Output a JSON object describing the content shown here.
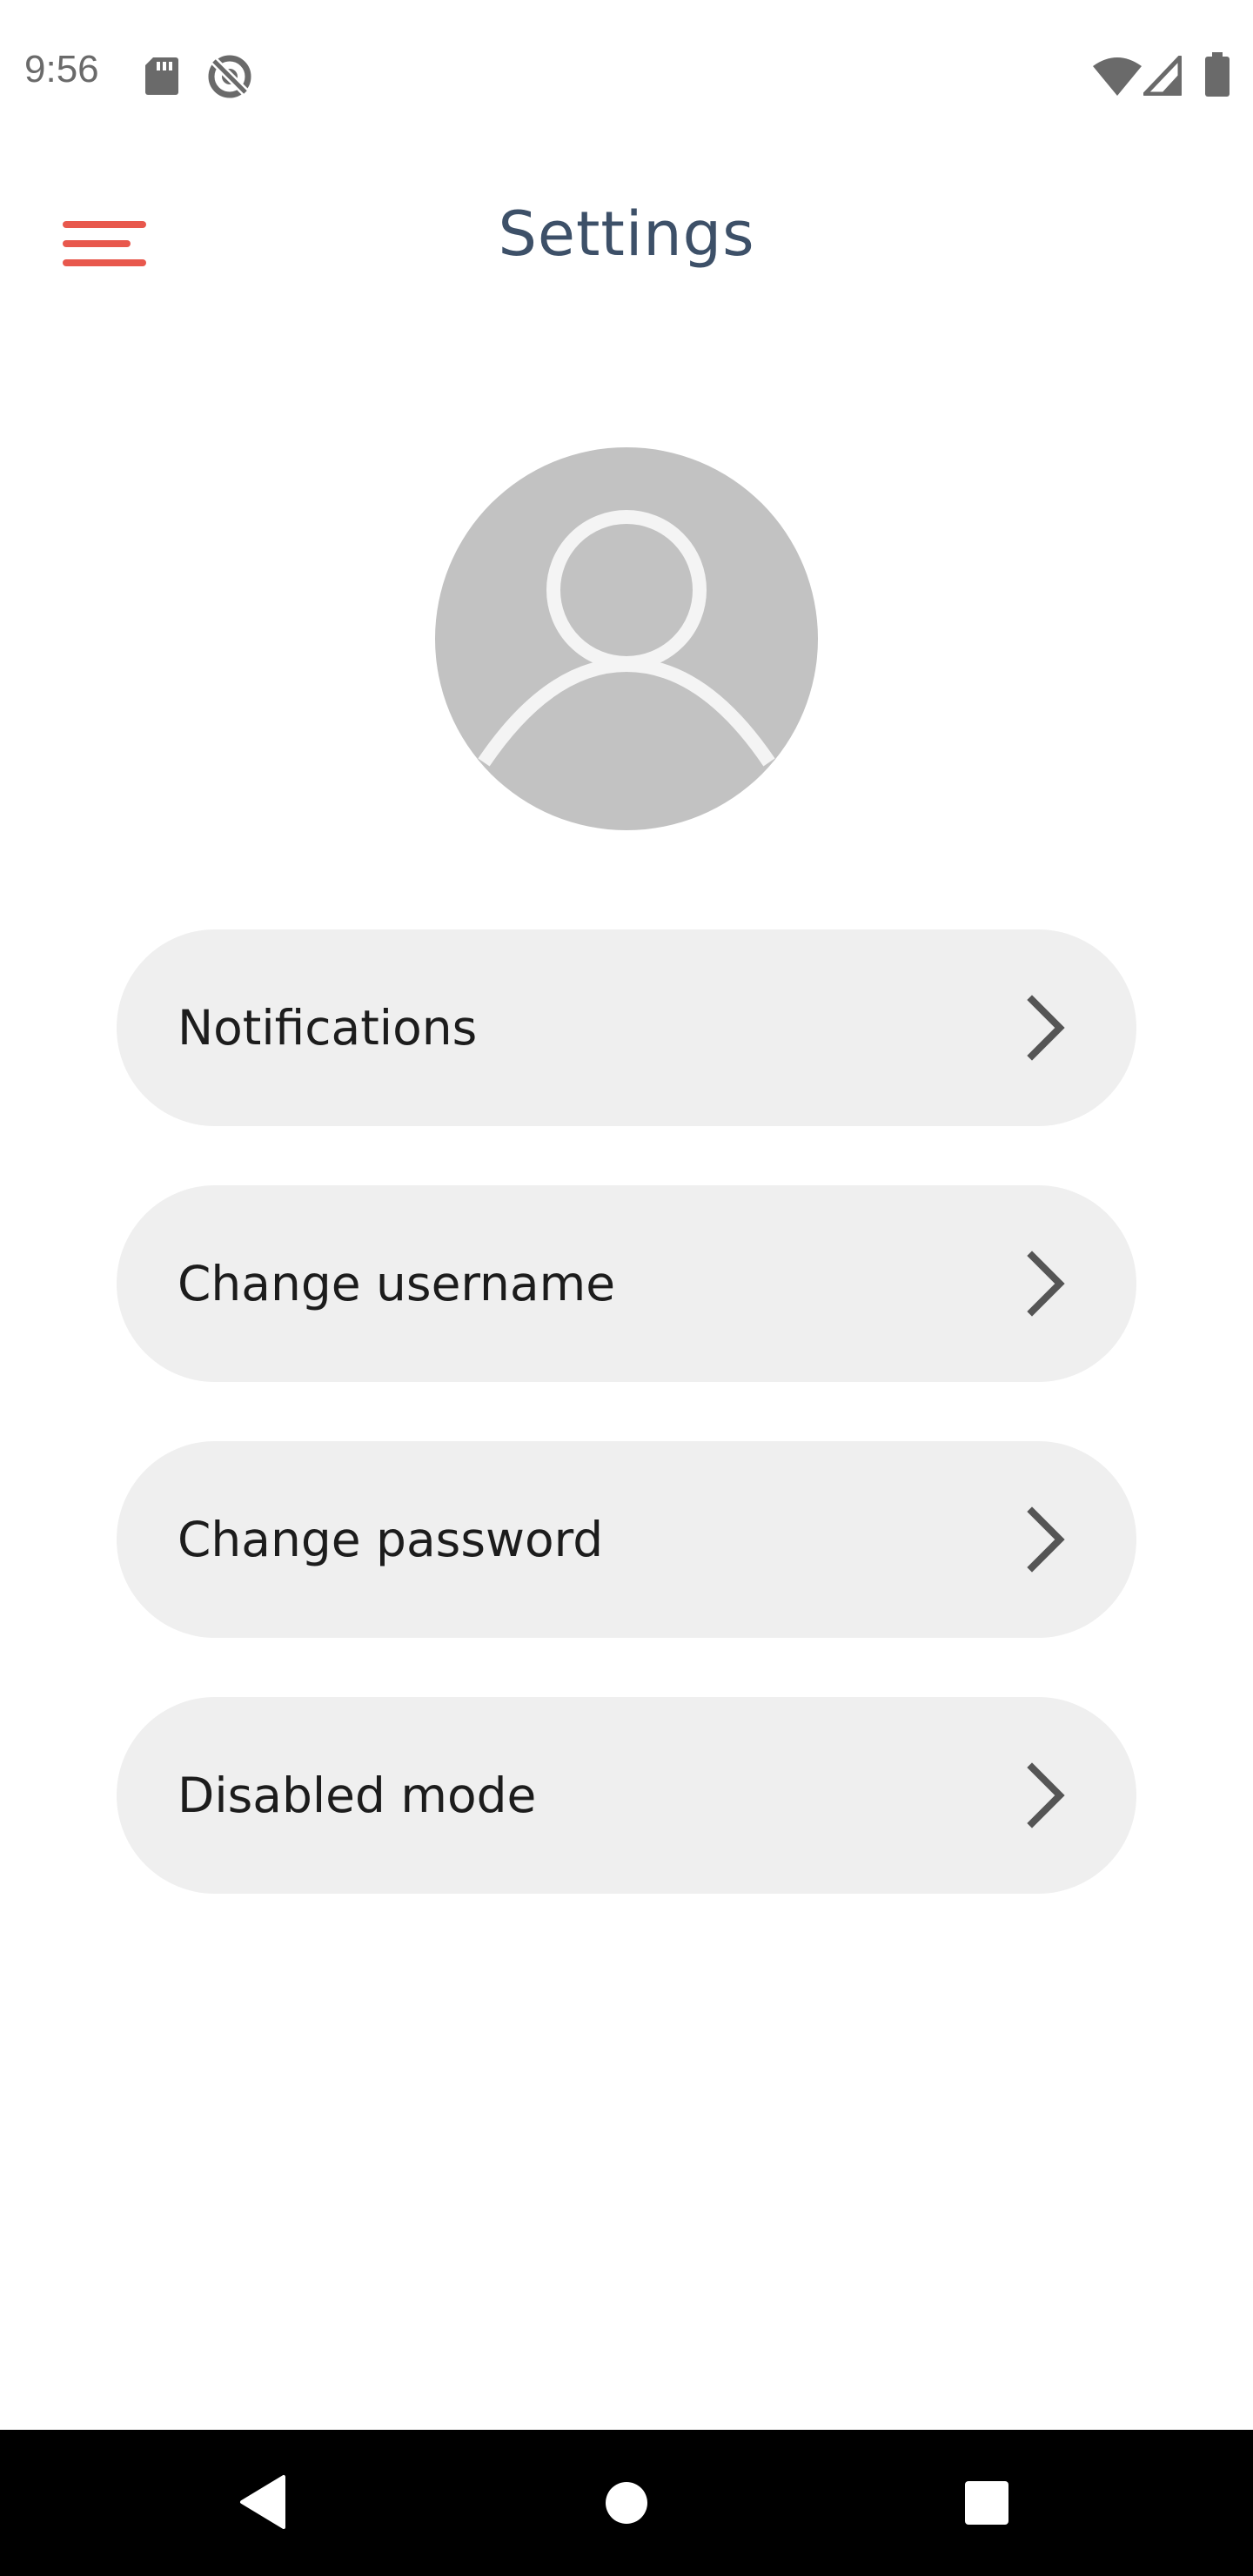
{
  "status_bar": {
    "time": "9:56",
    "icons": [
      "sd-card-icon",
      "no-sync-icon",
      "wifi-icon",
      "signal-icon",
      "battery-icon"
    ]
  },
  "app_bar": {
    "title": "Settings",
    "menu_icon": "hamburger-menu-icon",
    "accent_color": "#e8584d"
  },
  "profile": {
    "avatar_icon": "person-placeholder-icon"
  },
  "settings_items": [
    {
      "label": "Notifications",
      "icon": "chevron-right-icon"
    },
    {
      "label": "Change username",
      "icon": "chevron-right-icon"
    },
    {
      "label": "Change password",
      "icon": "chevron-right-icon"
    },
    {
      "label": "Disabled mode",
      "icon": "chevron-right-icon"
    }
  ],
  "nav_bar": {
    "buttons": [
      "back-icon",
      "home-icon",
      "recents-icon"
    ]
  }
}
